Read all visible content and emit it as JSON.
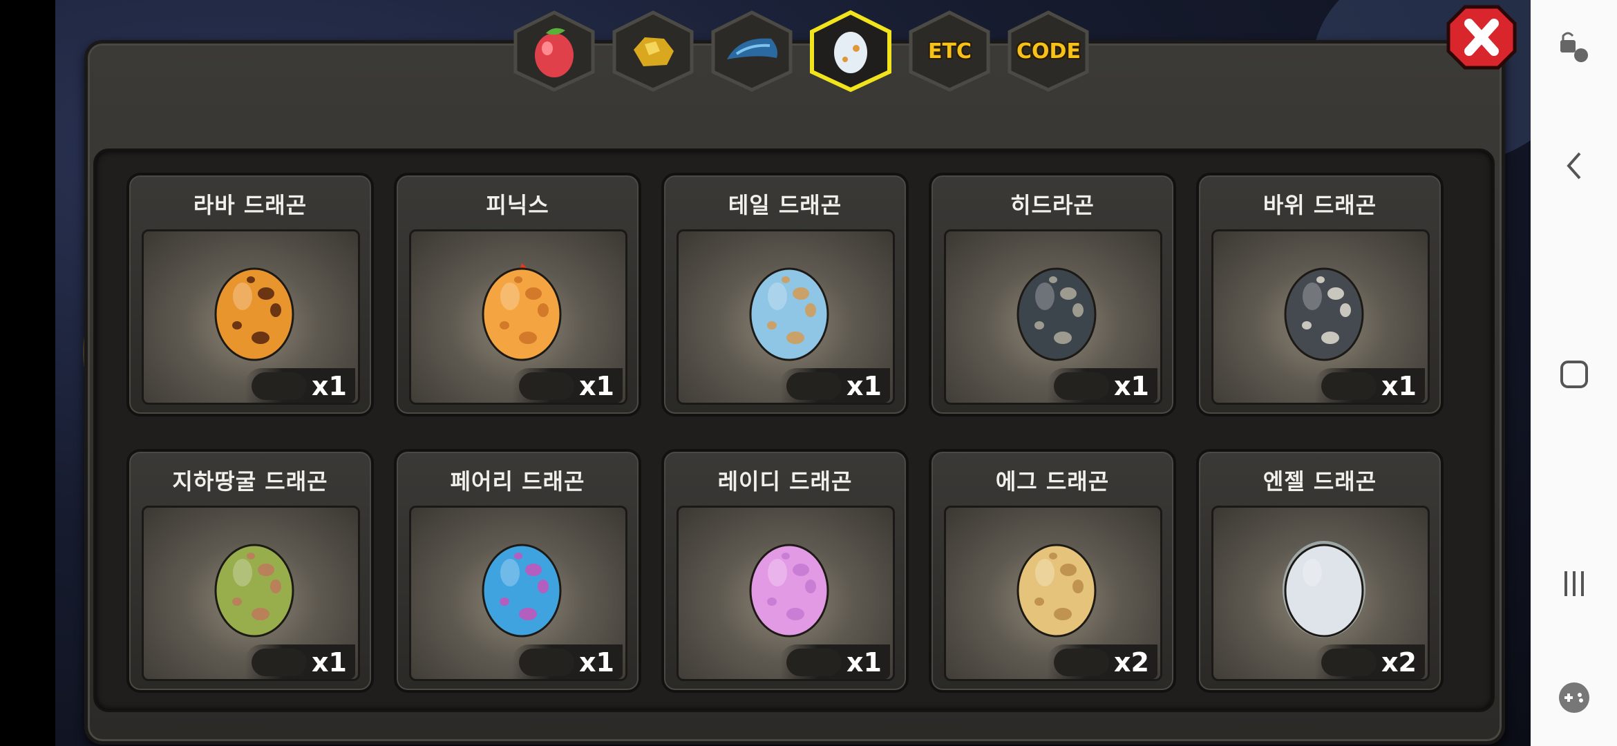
{
  "tabs": [
    {
      "name": "fruit",
      "icon": "fruit-icon",
      "label": ""
    },
    {
      "name": "gold",
      "icon": "gold-ore-icon",
      "label": ""
    },
    {
      "name": "scale",
      "icon": "dragon-scale-icon",
      "label": ""
    },
    {
      "name": "egg",
      "icon": "egg-icon",
      "label": "",
      "selected": true
    },
    {
      "name": "etc",
      "icon": "",
      "label": "ETC"
    },
    {
      "name": "code",
      "icon": "",
      "label": "CODE"
    }
  ],
  "eggs": [
    {
      "name": "라바 드래곤",
      "count": "x1",
      "color": "#e8952e",
      "spot": "#6b3514"
    },
    {
      "name": "피닉스",
      "count": "x1",
      "color": "#f4a441",
      "spot": "#d37a2a",
      "fire": true
    },
    {
      "name": "테일 드래곤",
      "count": "x1",
      "color": "#8fc6e6",
      "spot": "#c9a169"
    },
    {
      "name": "히드라곤",
      "count": "x1",
      "color": "#3d454c",
      "spot": "#9d9a8f"
    },
    {
      "name": "바위 드래곤",
      "count": "x1",
      "color": "#454a50",
      "spot": "#c9c6bd"
    },
    {
      "name": "지하땅굴 드래곤",
      "count": "x1",
      "color": "#98ad4c",
      "spot": "#b8815a"
    },
    {
      "name": "페어리 드래곤",
      "count": "x1",
      "color": "#3fa3e0",
      "spot": "#b25fc0"
    },
    {
      "name": "레이디 드래곤",
      "count": "x1",
      "color": "#e39ae5",
      "spot": "#c97dd4"
    },
    {
      "name": "에그 드래곤",
      "count": "x2",
      "color": "#e6c37a",
      "spot": "#c09350"
    },
    {
      "name": "엔젤 드래곤",
      "count": "x2",
      "color": "#dfe3ea",
      "spot": "#ffffff",
      "glow": true
    }
  ],
  "colors": {
    "accent": "#f6c21a",
    "panel": "#2f2e2b",
    "close": "#d8262c"
  }
}
